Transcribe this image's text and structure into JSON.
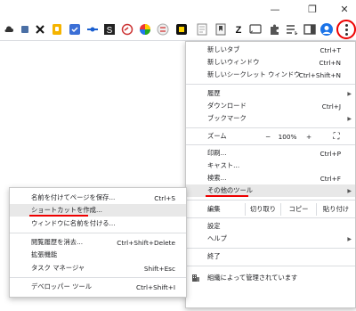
{
  "window": {
    "minimize": "—",
    "maximize": "❐",
    "close": "✕"
  },
  "extensions": [
    "cloud-icon",
    "note-icon",
    "x-icon",
    "keep-icon",
    "app-icon",
    "dot-icon",
    "s-icon",
    "edge-icon",
    "color-icon",
    "lr-icon",
    "app2-icon",
    "doc-icon",
    "bookmark-icon",
    "z-icon",
    "cast-icon",
    "puzzle-icon",
    "list-icon",
    "sidebar-icon",
    "profile-icon"
  ],
  "menu": {
    "new_tab": {
      "label": "新しいタブ",
      "shortcut": "Ctrl+T"
    },
    "new_window": {
      "label": "新しいウィンドウ",
      "shortcut": "Ctrl+N"
    },
    "incognito": {
      "label": "新しいシークレット ウィンドウ",
      "shortcut": "Ctrl+Shift+N"
    },
    "history": {
      "label": "履歴"
    },
    "downloads": {
      "label": "ダウンロード",
      "shortcut": "Ctrl+J"
    },
    "bookmarks": {
      "label": "ブックマーク"
    },
    "zoom": {
      "label": "ズーム",
      "minus": "−",
      "value": "100%",
      "plus": "+",
      "fullscreen": "⛶"
    },
    "print": {
      "label": "印刷...",
      "shortcut": "Ctrl+P"
    },
    "cast": {
      "label": "キャスト..."
    },
    "find": {
      "label": "検索...",
      "shortcut": "Ctrl+F"
    },
    "more_tools": {
      "label": "その他のツール"
    },
    "edit": {
      "label": "編集",
      "cut": "切り取り",
      "copy": "コピー",
      "paste": "貼り付け"
    },
    "settings": {
      "label": "設定"
    },
    "help": {
      "label": "ヘルプ"
    },
    "exit": {
      "label": "終了"
    },
    "managed": {
      "label": "組織によって管理されています"
    }
  },
  "submenu": {
    "save_page": {
      "label": "名前を付けてページを保存...",
      "shortcut": "Ctrl+S"
    },
    "create_shortcut": {
      "label": "ショートカットを作成..."
    },
    "name_window": {
      "label": "ウィンドウに名前を付ける..."
    },
    "clear_data": {
      "label": "閲覧履歴を消去...",
      "shortcut": "Ctrl+Shift+Delete"
    },
    "extensions": {
      "label": "拡張機能"
    },
    "task_manager": {
      "label": "タスク マネージャ",
      "shortcut": "Shift+Esc"
    },
    "devtools": {
      "label": "デベロッパー ツール",
      "shortcut": "Ctrl+Shift+I"
    }
  },
  "colors": {
    "highlight_red": "#e00000",
    "menu_border": "#c8c8c8"
  }
}
